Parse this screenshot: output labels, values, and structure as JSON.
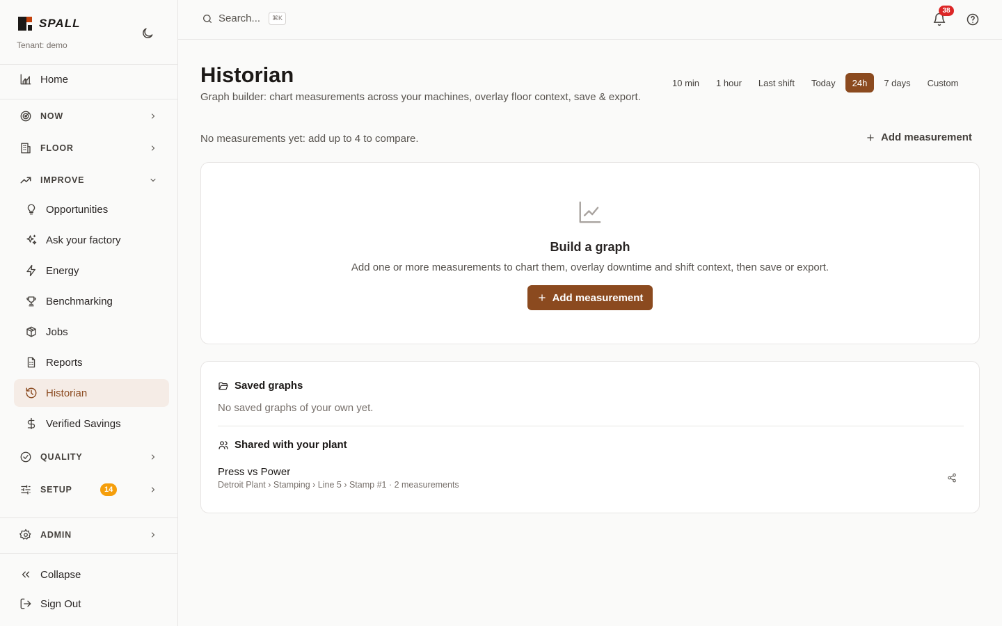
{
  "brand": {
    "name": "SPALL",
    "tenant": "Tenant: demo"
  },
  "sidebar": {
    "home": "Home",
    "groups": {
      "now": "NOW",
      "floor": "FLOOR",
      "improve": "IMPROVE",
      "quality": "QUALITY",
      "setup": "SETUP",
      "admin": "ADMIN"
    },
    "setup_badge": "14",
    "improve_items": [
      {
        "label": "Opportunities",
        "icon": "lightbulb-icon"
      },
      {
        "label": "Ask your factory",
        "icon": "sparkles-icon"
      },
      {
        "label": "Energy",
        "icon": "zap-icon"
      },
      {
        "label": "Benchmarking",
        "icon": "trophy-icon"
      },
      {
        "label": "Jobs",
        "icon": "package-icon"
      },
      {
        "label": "Reports",
        "icon": "report-icon"
      },
      {
        "label": "Historian",
        "icon": "history-icon",
        "active": true
      },
      {
        "label": "Verified Savings",
        "icon": "dollar-icon"
      }
    ],
    "collapse": "Collapse",
    "sign_out": "Sign Out"
  },
  "topbar": {
    "search_placeholder": "Search...",
    "shortcut": "⌘K",
    "notifications_count": "38"
  },
  "page": {
    "title": "Historian",
    "subtitle": "Graph builder: chart measurements across your machines, overlay floor context, save & export.",
    "ranges": [
      "10 min",
      "1 hour",
      "Last shift",
      "Today",
      "24h",
      "7 days",
      "Custom"
    ],
    "selected_range": "24h",
    "status": "No measurements yet: add up to 4 to compare.",
    "add_measurement": "Add measurement"
  },
  "empty_state": {
    "title": "Build a graph",
    "description": "Add one or more measurements to chart them, overlay downtime and shift context, then save or export.",
    "button": "Add measurement"
  },
  "saved": {
    "title": "Saved graphs",
    "empty": "No saved graphs of your own yet.",
    "shared_title": "Shared with your plant",
    "shared": [
      {
        "name": "Press vs Power",
        "meta": "Detroit Plant › Stamping › Line 5 › Stamp #1 · 2 measurements"
      }
    ]
  },
  "colors": {
    "accent": "#8b4a1f",
    "active_bg": "#f5ece6",
    "badge_orange": "#f59e0b",
    "badge_red": "#dc2626"
  }
}
